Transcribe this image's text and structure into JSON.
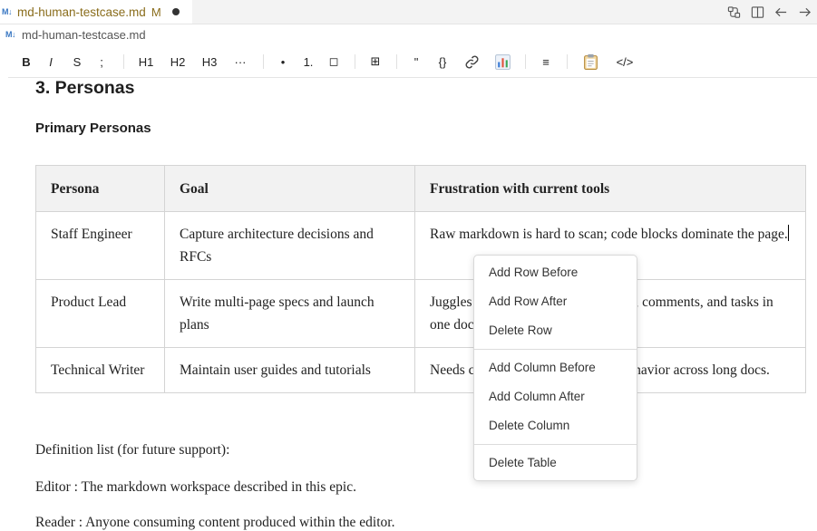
{
  "tab": {
    "badge": "M↓",
    "title": "md-human-testcase.md",
    "modified": "M"
  },
  "tab_actions": [
    "compare-changes-icon",
    "split-editor-icon",
    "go-back-icon",
    "go-forward-icon"
  ],
  "breadcrumb": {
    "badge": "M↓",
    "file": "md-human-testcase.md"
  },
  "toolbar": {
    "bold": "B",
    "italic": "I",
    "strike": "S",
    "code": ";",
    "h1": "H1",
    "h2": "H2",
    "h3": "H3",
    "more": "···",
    "bullet": "•",
    "ordered": "1.",
    "task": "◻",
    "table": "⊞",
    "quote": "\"",
    "codeblock": "{}",
    "link": "🔗",
    "chart": "📊",
    "align": "≡",
    "clipboard": "📋",
    "source": "</>"
  },
  "doc": {
    "heading": "3. Personas",
    "subheading": "Primary Personas",
    "table": {
      "headers": [
        "Persona",
        "Goal",
        "Frustration with current tools"
      ],
      "rows": [
        [
          "Staff Engineer",
          "Capture architecture decisions and RFCs",
          "Raw markdown is hard to scan; code blocks dominate the page."
        ],
        [
          "Product Lead",
          "Write multi-page specs and launch plans",
          "Juggles headings, embedded content, comments, and tasks in one doc."
        ],
        [
          "Technical Writer",
          "Maintain user guides and tutorials",
          "Needs consistent heading and list behavior across long docs."
        ]
      ]
    },
    "para1": "Definition list (for future support):",
    "para2": "Editor : The markdown workspace described in this epic.",
    "para3": "Reader : Anyone consuming content produced within the editor."
  },
  "context_menu": {
    "add_row_before": "Add Row Before",
    "add_row_after": "Add Row After",
    "delete_row": "Delete Row",
    "add_col_before": "Add Column Before",
    "add_col_after": "Add Column After",
    "delete_col": "Delete Column",
    "delete_table": "Delete Table"
  },
  "colors": {
    "modified_tab": "#8a6d1c",
    "md_badge": "#3a78c3",
    "table_header_bg": "#f2f2f2"
  }
}
